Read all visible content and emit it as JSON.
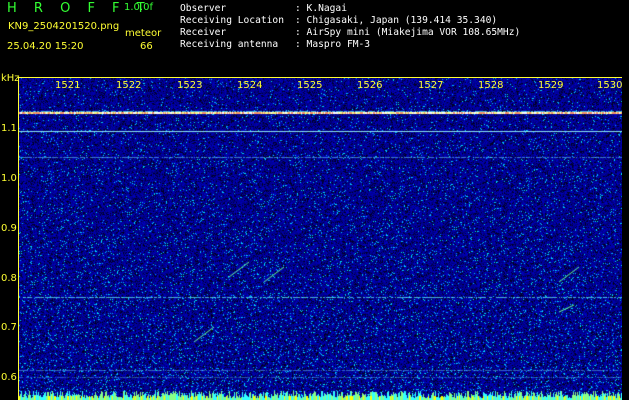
{
  "header": {
    "app_title": "H R O F F T",
    "version": "1.0.0f",
    "filename": "KN9_2504201520.png",
    "meteor_label": "meteor",
    "timestamp": "25.04.20 15:20",
    "meteor_count": "66"
  },
  "info": [
    {
      "label": "Observer",
      "value": ": K.Nagai"
    },
    {
      "label": "Receiving Location",
      "value": ": Chigasaki, Japan (139.414 35.340)"
    },
    {
      "label": "Receiver",
      "value": ": AirSpy mini (Miakejima VOR 108.65MHz)"
    },
    {
      "label": "Receiving antenna",
      "value": ": Maspro FM-3"
    }
  ],
  "axis": {
    "y_unit": "kHz",
    "y_ticks": [
      "1.1",
      "1.0",
      "0.9",
      "0.8",
      "0.7",
      "0.6"
    ],
    "x_ticks": [
      "1521",
      "1522",
      "1523",
      "1524",
      "1525",
      "1526",
      "1527",
      "1528",
      "1529",
      "1530"
    ]
  },
  "colors": {
    "label_yellow": "#ffff33",
    "label_green": "#33ff33",
    "background": "#000000",
    "noise_base": "#0000a0"
  }
}
